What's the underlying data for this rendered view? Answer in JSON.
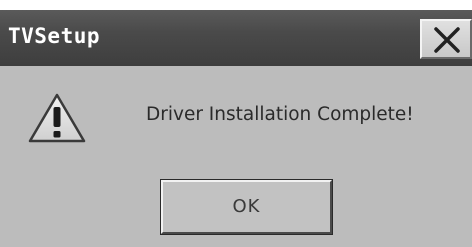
{
  "window": {
    "title": "TVSetup",
    "close_label": "Close"
  },
  "dialog": {
    "icon": "warning-icon",
    "message": "Driver Installation Complete!",
    "ok_label": "OK"
  },
  "colors": {
    "titlebar": "#4a4a4a",
    "body": "#bcbcbc"
  }
}
